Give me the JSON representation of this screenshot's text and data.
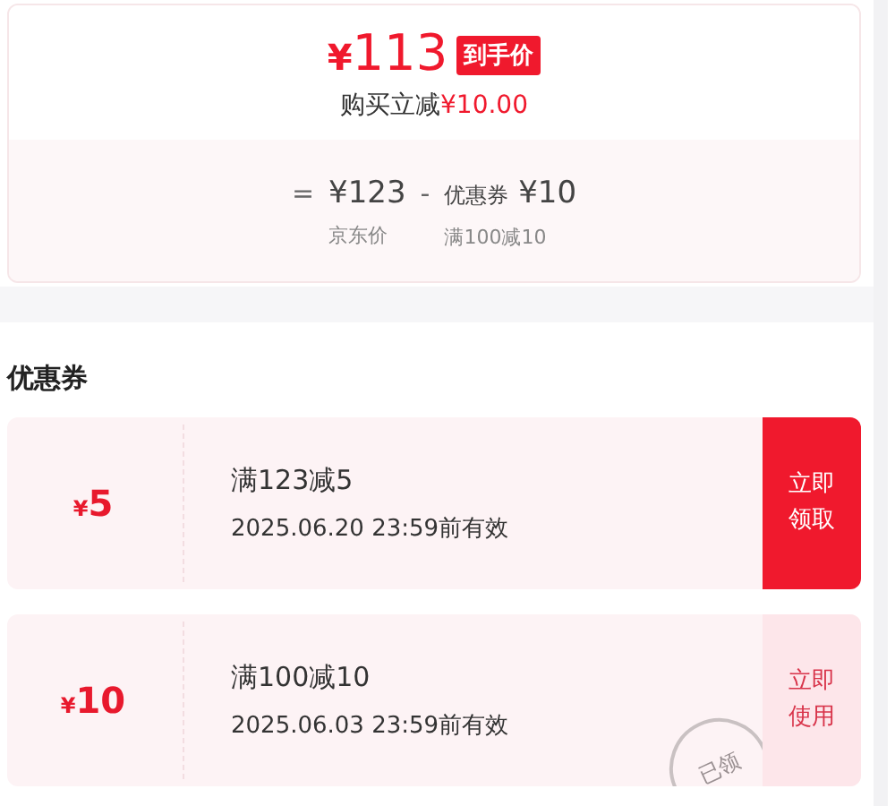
{
  "price": {
    "currency": "¥",
    "amount": "113",
    "badge": "到手价"
  },
  "saving": {
    "label": "购买立减",
    "amount": "¥10.00"
  },
  "breakdown": {
    "equals": "=",
    "base_price": "¥123",
    "minus": "-",
    "coupon_label": "优惠券",
    "coupon_value": "¥10",
    "base_caption": "京东价",
    "coupon_caption": "满100减10"
  },
  "section_title": "优惠券",
  "coupons": [
    {
      "currency": "¥",
      "amount": "5",
      "title": "满123减5",
      "validity": "2025.06.20 23:59前有效",
      "action": "立即领取",
      "claimed": false
    },
    {
      "currency": "¥",
      "amount": "10",
      "title": "满100减10",
      "validity": "2025.06.03 23:59前有效",
      "action": "立即使用",
      "claimed": true,
      "stamp": "已领"
    }
  ]
}
